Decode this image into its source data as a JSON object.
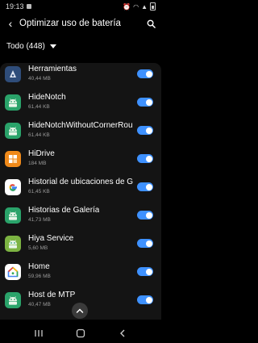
{
  "status_bar": {
    "time": "19:13"
  },
  "header": {
    "title": "Optimizar uso de batería"
  },
  "filter": {
    "label": "Todo (448)"
  },
  "apps": [
    {
      "name": "Herramientas",
      "size": "40,44 MB",
      "icon": "tools-icon",
      "color": "#2f4d7a",
      "enabled": true
    },
    {
      "name": "HideNotch",
      "size": "61,44 KB",
      "icon": "android-icon",
      "color": "#2aa36a",
      "enabled": true
    },
    {
      "name": "HideNotchWithoutCornerRound",
      "size": "61,44 KB",
      "icon": "android-icon",
      "color": "#2aa36a",
      "enabled": true
    },
    {
      "name": "HiDrive",
      "size": "184 MB",
      "icon": "hidrive-icon",
      "color": "#f08a1a",
      "enabled": true
    },
    {
      "name": "Historial de ubicaciones de Goo...",
      "size": "61,45 KB",
      "icon": "google-icon",
      "color": "#ffffff",
      "enabled": true
    },
    {
      "name": "Historias de Galería",
      "size": "41,73 MB",
      "icon": "android-icon",
      "color": "#2aa36a",
      "enabled": true
    },
    {
      "name": "Hiya Service",
      "size": "5,60 MB",
      "icon": "android-icon",
      "color": "#7cb342",
      "enabled": true
    },
    {
      "name": "Home",
      "size": "59,96 MB",
      "icon": "google-home-icon",
      "color": "#ffffff",
      "enabled": true
    },
    {
      "name": "Host de MTP",
      "size": "40,47 MB",
      "icon": "android-icon",
      "color": "#2aa36a",
      "enabled": true
    }
  ]
}
